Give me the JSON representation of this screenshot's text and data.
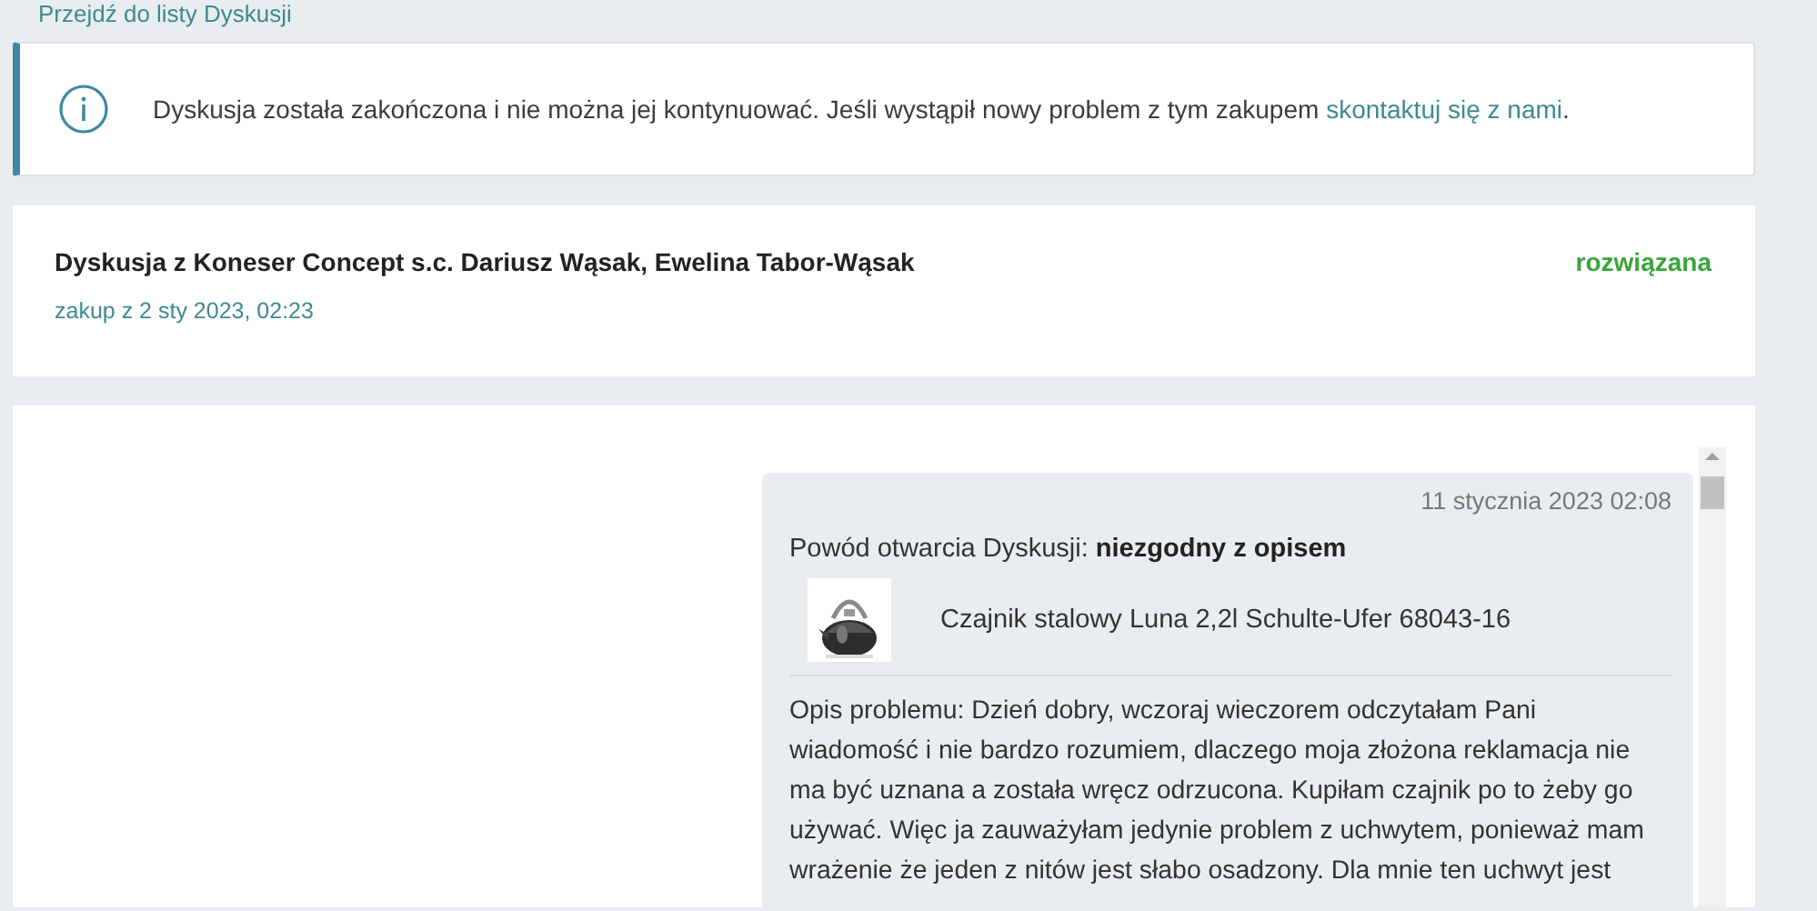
{
  "back_link": "Przejdź do listy Dyskusji",
  "notice": {
    "text": "Dyskusja została zakończona i nie można jej kontynuować. Jeśli wystąpił nowy problem z tym zakupem ",
    "link": "skontaktuj się z nami",
    "tail": "."
  },
  "discussion": {
    "title": "Dyskusja z Koneser Concept s.c. Dariusz Wąsak, Ewelina Tabor-Wąsak",
    "purchase": "zakup z 2 sty 2023, 02:23",
    "status": "rozwiązana"
  },
  "message": {
    "date": "11 stycznia 2023 02:08",
    "reason": "Powód otwarcia Dyskusji: **niezgodny z opisem**",
    "product": {
      "name": "Czajnik stalowy Luna 2,2l Schulte-Ufer 68043-16",
      "kind": "picture"
    },
    "body": "Opis problemu: Dzień dobry, wczoraj wieczorem odczytałam Pani wiadomość i nie bardzo rozumiem, dlaczego moja złożona reklamacja nie ma być uznana a została wręcz odrzucona. Kupiłam czajnik po to żeby go używać. Więc ja zauważyłam jedynie problem z uchwytem, ponieważ mam wrażenie że jeden z nitów jest słabo osadzony. Dla mnie ten uchwyt jest"
  }
}
